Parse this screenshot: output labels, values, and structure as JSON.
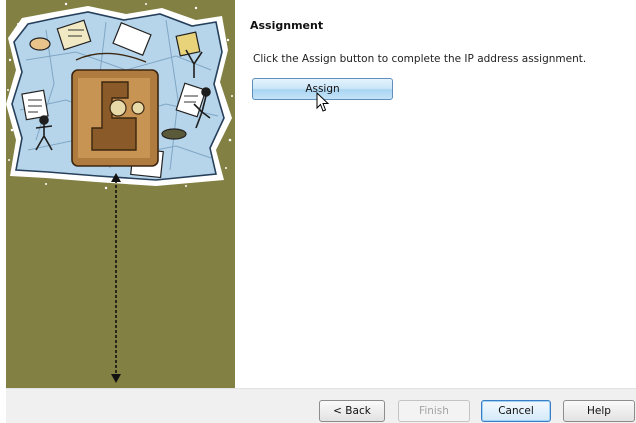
{
  "wizard": {
    "title": "Assignment",
    "instruction": "Click the Assign button to complete the IP address assignment.",
    "assign_label": "Assign"
  },
  "footer": {
    "back_label": "< Back",
    "finish_label": "Finish",
    "cancel_label": "Cancel",
    "help_label": "Help"
  },
  "colors": {
    "sidebar_background": "#838043",
    "assign_button_fill": "#c4e3f8",
    "footer_background": "#f0f0f0"
  },
  "icons": [
    "wizard-illustration",
    "mouse-pointer-icon",
    "double-arrow-icon"
  ]
}
